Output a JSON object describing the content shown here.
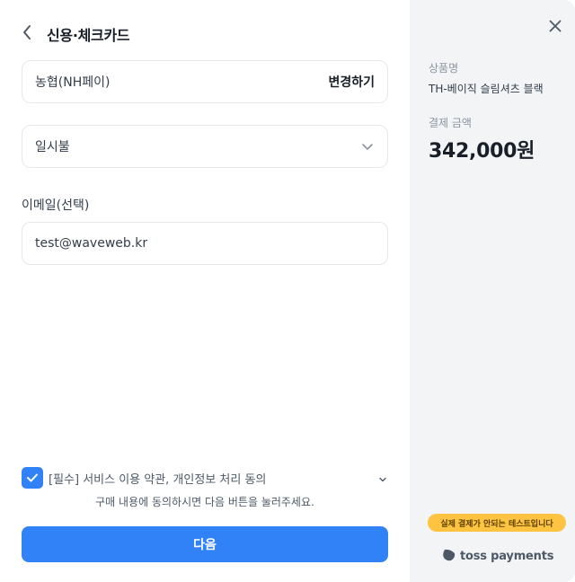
{
  "header": {
    "title": "신용·체크카드"
  },
  "card_field": {
    "value": "농협(NH페이)",
    "change_label": "변경하기"
  },
  "installment": {
    "selected": "일시불"
  },
  "email": {
    "label": "이메일(선택)",
    "value": "test@waveweb.kr"
  },
  "agreement": {
    "text": "[필수] 서비스 이용 약관, 개인정보 처리 동의",
    "checked": true,
    "notice": "구매 내용에 동의하시면 다음 버튼을 눌러주세요."
  },
  "next_button": {
    "label": "다음"
  },
  "summary": {
    "product_label": "상품명",
    "product_name": "TH-베이직 슬림셔츠 블랙",
    "amount_label": "결제 금액",
    "amount": "342,000원",
    "test_badge": "실제 결제가 안되는 테스트입니다",
    "brand": "toss payments"
  },
  "colors": {
    "accent": "#3182f6",
    "side_panel": "#f2f4f6",
    "badge": "#ffc342"
  },
  "icons": {
    "back": "chevron-left-icon",
    "close": "close-icon",
    "select_chevron": "chevron-down-icon",
    "check": "check-icon",
    "brand_logo": "toss-logo-icon"
  }
}
